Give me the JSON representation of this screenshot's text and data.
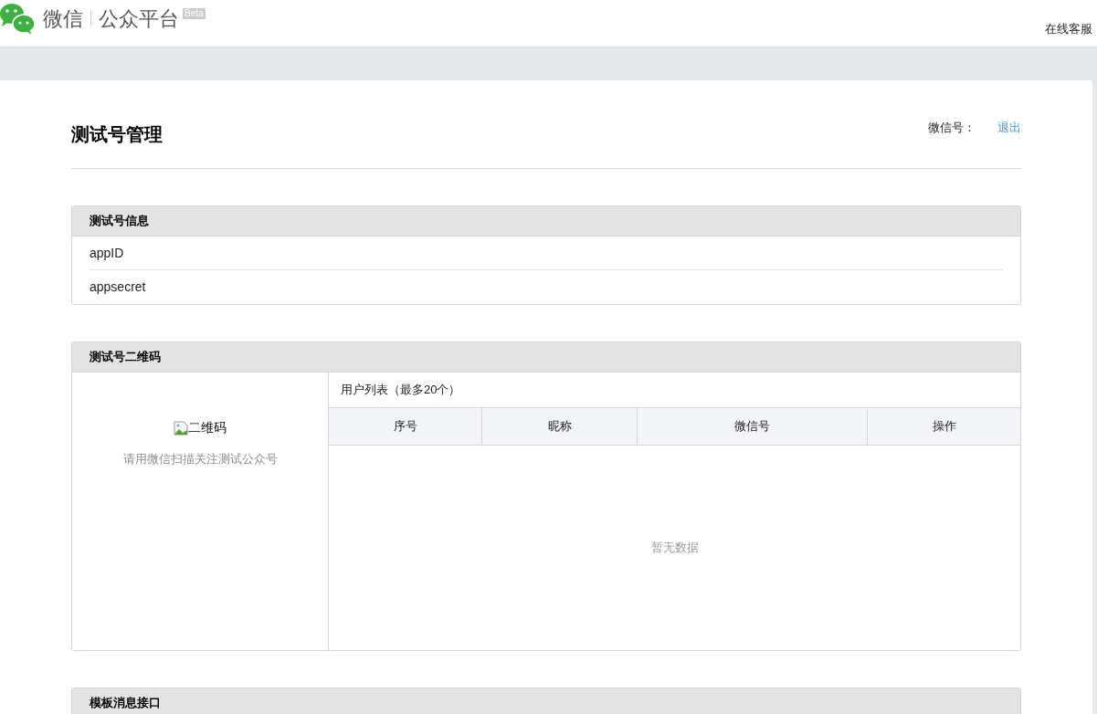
{
  "header": {
    "brand": "微信",
    "product": "公众平台",
    "badge": "Beta",
    "help_link": "在线客服"
  },
  "page": {
    "title": "测试号管理",
    "account_label": "微信号：",
    "logout_link": "退出"
  },
  "info_panel": {
    "title": "测试号信息",
    "rows": [
      "appID",
      "appsecret"
    ]
  },
  "qr_panel": {
    "title": "测试号二维码",
    "qr_alt": "二维码",
    "qr_hint": "请用微信扫描关注测试公众号",
    "user_list": {
      "title": "用户列表（最多20个）",
      "columns": [
        "序号",
        "昵称",
        "微信号",
        "操作"
      ],
      "empty_text": "暂无数据"
    }
  },
  "template_panel": {
    "title": "模板消息接口"
  }
}
